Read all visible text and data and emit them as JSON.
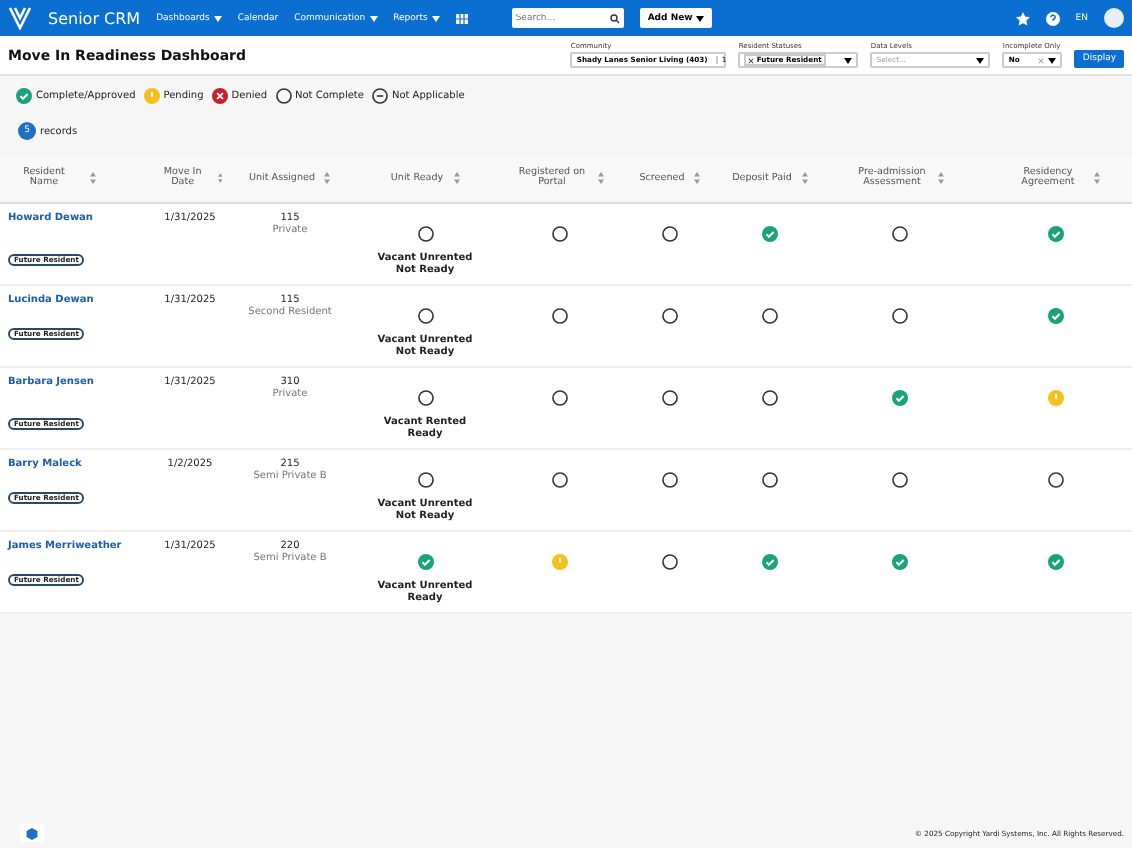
{
  "nav": {
    "brand": "Senior CRM",
    "menu": [
      {
        "label": "Dashboards",
        "dropdown": true
      },
      {
        "label": "Calendar",
        "dropdown": false
      },
      {
        "label": "Communication",
        "dropdown": true
      },
      {
        "label": "Reports",
        "dropdown": true
      }
    ],
    "search": {
      "placeholder": "Search..."
    },
    "add_button": "Add New",
    "language": "EN"
  },
  "page_title": "Move In Readiness Dashboard",
  "filters": [
    {
      "kind": "select",
      "label": "Community",
      "value": "Shady Lanes Senior Living (403)",
      "count": "1"
    },
    {
      "kind": "tags",
      "label": "Resident Statuses",
      "tags": [
        "Future Resident"
      ]
    },
    {
      "kind": "placeholder",
      "label": "Data Levels",
      "placeholder": "Select..."
    },
    {
      "kind": "select",
      "label": "Incomplete Only",
      "value": "No"
    }
  ],
  "display_button": "Display",
  "legend": [
    {
      "kind": "complete",
      "label": "Complete/Approved"
    },
    {
      "kind": "pending",
      "label": "Pending"
    },
    {
      "kind": "denied",
      "label": "Denied"
    },
    {
      "kind": "not_complete",
      "label": "Not Complete"
    },
    {
      "kind": "not_applicable",
      "label": "Not Applicable"
    }
  ],
  "records": {
    "count": "5",
    "label": "records"
  },
  "columns": [
    "Resident Name",
    "Move In Date",
    "Unit Assigned",
    "Unit Ready",
    "Registered on Portal",
    "Screened",
    "Deposit Paid",
    "Pre-admission Assessment",
    "Residency Agreement"
  ],
  "rows": [
    {
      "name": "Howard Dewan",
      "badge": "Future Resident",
      "date": "1/31/2025",
      "unit": "115",
      "unit_type": "Private",
      "ready": {
        "kind": "not_complete",
        "text": "Vacant Unrented Not Ready"
      },
      "checks": [
        {
          "kind": "not_complete"
        },
        {
          "kind": "not_complete"
        },
        {
          "kind": "complete"
        },
        {
          "kind": "not_complete"
        },
        {
          "kind": "complete"
        }
      ]
    },
    {
      "name": "Lucinda Dewan",
      "badge": "Future Resident",
      "date": "1/31/2025",
      "unit": "115",
      "unit_type": "Second Resident",
      "ready": {
        "kind": "not_complete",
        "text": "Vacant Unrented Not Ready"
      },
      "checks": [
        {
          "kind": "not_complete"
        },
        {
          "kind": "not_complete"
        },
        {
          "kind": "not_complete"
        },
        {
          "kind": "not_complete"
        },
        {
          "kind": "complete"
        }
      ]
    },
    {
      "name": "Barbara Jensen",
      "badge": "Future Resident",
      "date": "1/31/2025",
      "unit": "310",
      "unit_type": "Private",
      "ready": {
        "kind": "not_complete",
        "text": "Vacant Rented Ready"
      },
      "checks": [
        {
          "kind": "not_complete"
        },
        {
          "kind": "not_complete"
        },
        {
          "kind": "not_complete"
        },
        {
          "kind": "complete"
        },
        {
          "kind": "pending"
        }
      ]
    },
    {
      "name": "Barry Maleck",
      "badge": "Future Resident",
      "date": "1/2/2025",
      "unit": "215",
      "unit_type": "Semi Private B",
      "ready": {
        "kind": "not_complete",
        "text": "Vacant Unrented Not Ready"
      },
      "checks": [
        {
          "kind": "not_complete"
        },
        {
          "kind": "not_complete"
        },
        {
          "kind": "not_complete"
        },
        {
          "kind": "not_complete"
        },
        {
          "kind": "not_complete"
        }
      ]
    },
    {
      "name": "James Merriweather",
      "badge": "Future Resident",
      "date": "1/31/2025",
      "unit": "220",
      "unit_type": "Semi Private B",
      "ready": {
        "kind": "complete",
        "text": "Vacant Unrented Ready"
      },
      "checks": [
        {
          "kind": "pending"
        },
        {
          "kind": "not_complete"
        },
        {
          "kind": "complete"
        },
        {
          "kind": "complete"
        },
        {
          "kind": "complete"
        }
      ]
    }
  ],
  "footer": "© 2025 Copyright Yardi Systems, Inc. All Rights Reserved."
}
